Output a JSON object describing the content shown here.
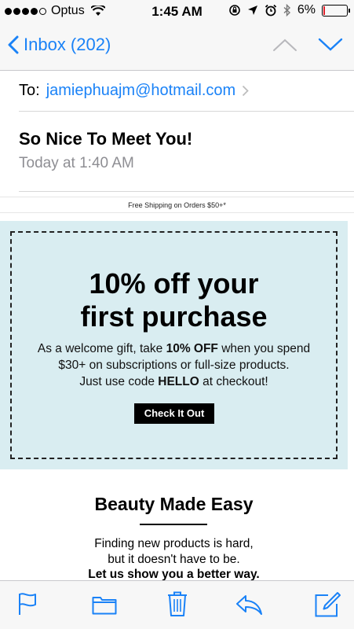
{
  "status_bar": {
    "carrier": "Optus",
    "time": "1:45 AM",
    "battery_text": "6%",
    "battery_level": 0.06,
    "battery_color": "#e0202a",
    "signal_bars": 4
  },
  "nav": {
    "back_label": "Inbox (202)",
    "prev_icon": "chevron-up-icon",
    "next_icon": "chevron-down-icon"
  },
  "message": {
    "to_label": "To:",
    "to_address": "jamiephuajm@hotmail.com",
    "subject": "So Nice To Meet You!",
    "date": "Today at 1:40 AM"
  },
  "email": {
    "shipping_banner": "Free Shipping on Orders $50+*",
    "promo_line1": "10% off your",
    "promo_line2": "first purchase",
    "desc_line1_a": "As a welcome gift, take ",
    "desc_line1_b": "10% OFF",
    "desc_line1_c": " when you spend",
    "desc_line2": "$30+ on subscriptions or full-size products.",
    "desc_line3_a": "Just use code ",
    "desc_line3_b": "HELLO",
    "desc_line3_c": " at checkout!",
    "cta_label": "Check It Out",
    "section_title": "Beauty Made Easy",
    "para_line1": "Finding new products is hard,",
    "para_line2": "but it doesn't have to be.",
    "para_line3": "Let us show you a better way.",
    "promo_bg": "#d9edf1"
  },
  "toolbar": {
    "icons": [
      "flag-icon",
      "folder-icon",
      "trash-icon",
      "reply-icon",
      "compose-icon"
    ],
    "accent": "#1a82f7"
  }
}
